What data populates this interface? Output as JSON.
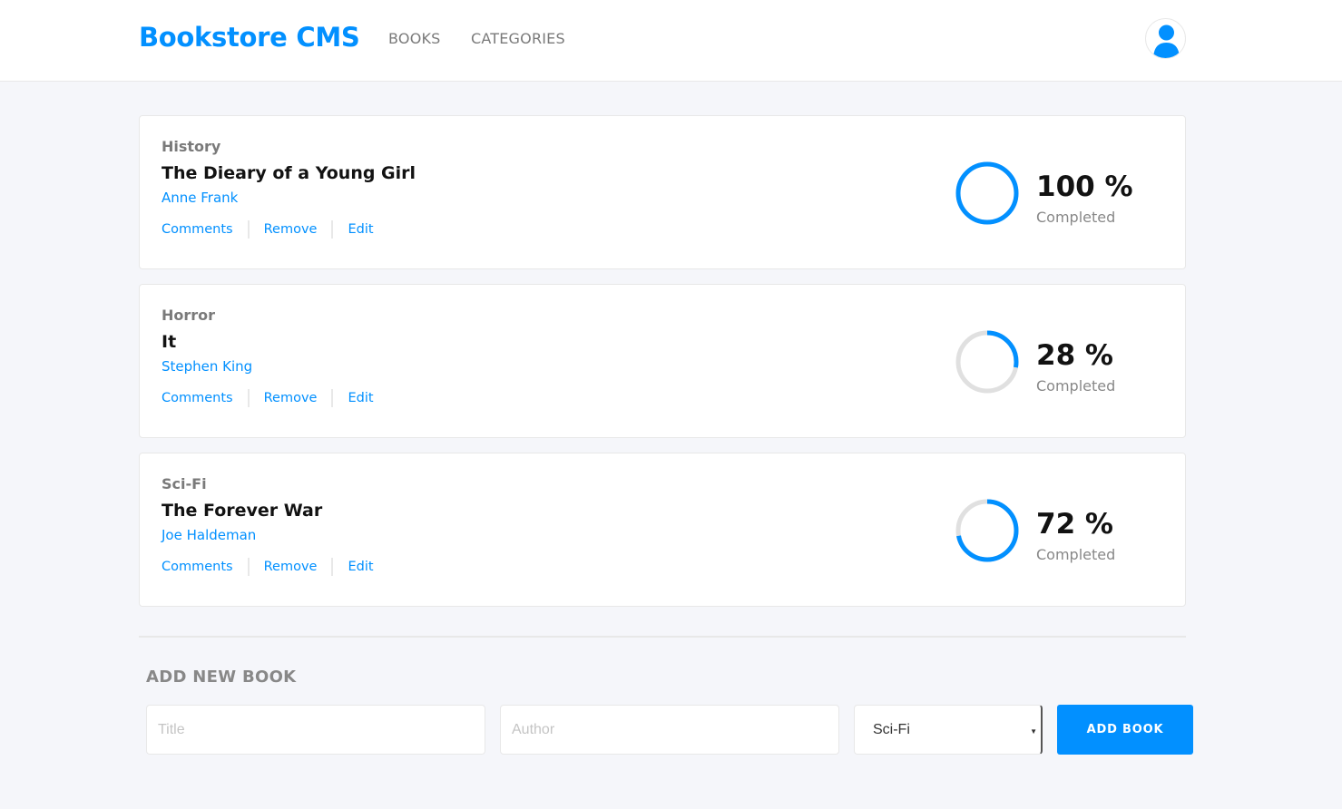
{
  "header": {
    "brand": "Bookstore CMS",
    "nav": {
      "books": "BOOKS",
      "categories": "CATEGORIES"
    },
    "avatar_icon": "user-icon"
  },
  "books": [
    {
      "category": "History",
      "title": "The Dieary of a Young Girl",
      "author": "Anne Frank",
      "progress": 100,
      "percent_label": "100 %",
      "completed_label": "Completed",
      "actions": {
        "comments": "Comments",
        "remove": "Remove",
        "edit": "Edit"
      }
    },
    {
      "category": "Horror",
      "title": "It",
      "author": "Stephen King",
      "progress": 28,
      "percent_label": "28 %",
      "completed_label": "Completed",
      "actions": {
        "comments": "Comments",
        "remove": "Remove",
        "edit": "Edit"
      }
    },
    {
      "category": "Sci-Fi",
      "title": "The Forever War",
      "author": "Joe Haldeman",
      "progress": 72,
      "percent_label": "72 %",
      "completed_label": "Completed",
      "actions": {
        "comments": "Comments",
        "remove": "Remove",
        "edit": "Edit"
      }
    }
  ],
  "form": {
    "heading": "ADD NEW BOOK",
    "title_placeholder": "Title",
    "author_placeholder": "Author",
    "category_selected": "Sci-Fi",
    "submit_label": "ADD BOOK"
  },
  "colors": {
    "accent": "#0290ff",
    "ring_track": "#e0e0e0"
  }
}
